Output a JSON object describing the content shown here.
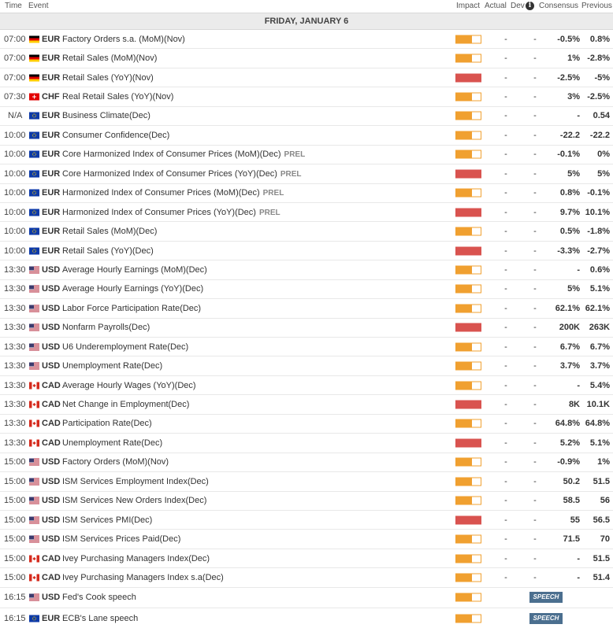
{
  "header": {
    "time": "Time",
    "event": "Event",
    "impact": "Impact",
    "actual": "Actual",
    "dev": "Dev",
    "info_icon": "i",
    "consensus": "Consensus",
    "previous": "Previous"
  },
  "day": "FRIDAY, JANUARY 6",
  "colors": {
    "impact_medium": "#f0a030",
    "impact_high": "#d9534f",
    "speech_badge": "#4b6f8f"
  },
  "rows": [
    {
      "time": "07:00",
      "flag": "de-flag",
      "currency": "EUR",
      "event": "Factory Orders s.a. (MoM)(Nov)",
      "prel": "",
      "impact": "medium",
      "actual": "-",
      "dev": "-",
      "consensus": "-0.5%",
      "previous": "0.8%"
    },
    {
      "time": "07:00",
      "flag": "de-flag",
      "currency": "EUR",
      "event": "Retail Sales (MoM)(Nov)",
      "prel": "",
      "impact": "medium",
      "actual": "-",
      "dev": "-",
      "consensus": "1%",
      "previous": "-2.8%"
    },
    {
      "time": "07:00",
      "flag": "de-flag",
      "currency": "EUR",
      "event": "Retail Sales (YoY)(Nov)",
      "prel": "",
      "impact": "high",
      "actual": "-",
      "dev": "-",
      "consensus": "-2.5%",
      "previous": "-5%"
    },
    {
      "time": "07:30",
      "flag": "ch-flag",
      "currency": "CHF",
      "event": "Real Retail Sales (YoY)(Nov)",
      "prel": "",
      "impact": "medium",
      "actual": "-",
      "dev": "-",
      "consensus": "3%",
      "previous": "-2.5%"
    },
    {
      "time": "N/A",
      "flag": "eu-flag",
      "currency": "EUR",
      "event": "Business Climate(Dec)",
      "prel": "",
      "impact": "medium",
      "actual": "-",
      "dev": "-",
      "consensus": "-",
      "previous": "0.54"
    },
    {
      "time": "10:00",
      "flag": "eu-flag",
      "currency": "EUR",
      "event": "Consumer Confidence(Dec)",
      "prel": "",
      "impact": "medium",
      "actual": "-",
      "dev": "-",
      "consensus": "-22.2",
      "previous": "-22.2"
    },
    {
      "time": "10:00",
      "flag": "eu-flag",
      "currency": "EUR",
      "event": "Core Harmonized Index of Consumer Prices (MoM)(Dec)",
      "prel": "PREL",
      "impact": "medium",
      "actual": "-",
      "dev": "-",
      "consensus": "-0.1%",
      "previous": "0%"
    },
    {
      "time": "10:00",
      "flag": "eu-flag",
      "currency": "EUR",
      "event": "Core Harmonized Index of Consumer Prices (YoY)(Dec)",
      "prel": "PREL",
      "impact": "high",
      "actual": "-",
      "dev": "-",
      "consensus": "5%",
      "previous": "5%"
    },
    {
      "time": "10:00",
      "flag": "eu-flag",
      "currency": "EUR",
      "event": "Harmonized Index of Consumer Prices (MoM)(Dec)",
      "prel": "PREL",
      "impact": "medium",
      "actual": "-",
      "dev": "-",
      "consensus": "0.8%",
      "previous": "-0.1%"
    },
    {
      "time": "10:00",
      "flag": "eu-flag",
      "currency": "EUR",
      "event": "Harmonized Index of Consumer Prices (YoY)(Dec)",
      "prel": "PREL",
      "impact": "high",
      "actual": "-",
      "dev": "-",
      "consensus": "9.7%",
      "previous": "10.1%"
    },
    {
      "time": "10:00",
      "flag": "eu-flag",
      "currency": "EUR",
      "event": "Retail Sales (MoM)(Dec)",
      "prel": "",
      "impact": "medium",
      "actual": "-",
      "dev": "-",
      "consensus": "0.5%",
      "previous": "-1.8%"
    },
    {
      "time": "10:00",
      "flag": "eu-flag",
      "currency": "EUR",
      "event": "Retail Sales (YoY)(Dec)",
      "prel": "",
      "impact": "high",
      "actual": "-",
      "dev": "-",
      "consensus": "-3.3%",
      "previous": "-2.7%"
    },
    {
      "time": "13:30",
      "flag": "us-flag",
      "currency": "USD",
      "event": "Average Hourly Earnings (MoM)(Dec)",
      "prel": "",
      "impact": "medium",
      "actual": "-",
      "dev": "-",
      "consensus": "-",
      "previous": "0.6%"
    },
    {
      "time": "13:30",
      "flag": "us-flag",
      "currency": "USD",
      "event": "Average Hourly Earnings (YoY)(Dec)",
      "prel": "",
      "impact": "medium",
      "actual": "-",
      "dev": "-",
      "consensus": "5%",
      "previous": "5.1%"
    },
    {
      "time": "13:30",
      "flag": "us-flag",
      "currency": "USD",
      "event": "Labor Force Participation Rate(Dec)",
      "prel": "",
      "impact": "medium",
      "actual": "-",
      "dev": "-",
      "consensus": "62.1%",
      "previous": "62.1%"
    },
    {
      "time": "13:30",
      "flag": "us-flag",
      "currency": "USD",
      "event": "Nonfarm Payrolls(Dec)",
      "prel": "",
      "impact": "high",
      "actual": "-",
      "dev": "-",
      "consensus": "200K",
      "previous": "263K"
    },
    {
      "time": "13:30",
      "flag": "us-flag",
      "currency": "USD",
      "event": "U6 Underemployment Rate(Dec)",
      "prel": "",
      "impact": "medium",
      "actual": "-",
      "dev": "-",
      "consensus": "6.7%",
      "previous": "6.7%"
    },
    {
      "time": "13:30",
      "flag": "us-flag",
      "currency": "USD",
      "event": "Unemployment Rate(Dec)",
      "prel": "",
      "impact": "medium",
      "actual": "-",
      "dev": "-",
      "consensus": "3.7%",
      "previous": "3.7%"
    },
    {
      "time": "13:30",
      "flag": "ca-flag",
      "currency": "CAD",
      "event": "Average Hourly Wages (YoY)(Dec)",
      "prel": "",
      "impact": "medium",
      "actual": "-",
      "dev": "-",
      "consensus": "-",
      "previous": "5.4%"
    },
    {
      "time": "13:30",
      "flag": "ca-flag",
      "currency": "CAD",
      "event": "Net Change in Employment(Dec)",
      "prel": "",
      "impact": "high",
      "actual": "-",
      "dev": "-",
      "consensus": "8K",
      "previous": "10.1K"
    },
    {
      "time": "13:30",
      "flag": "ca-flag",
      "currency": "CAD",
      "event": "Participation Rate(Dec)",
      "prel": "",
      "impact": "medium",
      "actual": "-",
      "dev": "-",
      "consensus": "64.8%",
      "previous": "64.8%"
    },
    {
      "time": "13:30",
      "flag": "ca-flag",
      "currency": "CAD",
      "event": "Unemployment Rate(Dec)",
      "prel": "",
      "impact": "high",
      "actual": "-",
      "dev": "-",
      "consensus": "5.2%",
      "previous": "5.1%"
    },
    {
      "time": "15:00",
      "flag": "us-flag",
      "currency": "USD",
      "event": "Factory Orders (MoM)(Nov)",
      "prel": "",
      "impact": "medium",
      "actual": "-",
      "dev": "-",
      "consensus": "-0.9%",
      "previous": "1%"
    },
    {
      "time": "15:00",
      "flag": "us-flag",
      "currency": "USD",
      "event": "ISM Services Employment Index(Dec)",
      "prel": "",
      "impact": "medium",
      "actual": "-",
      "dev": "-",
      "consensus": "50.2",
      "previous": "51.5"
    },
    {
      "time": "15:00",
      "flag": "us-flag",
      "currency": "USD",
      "event": "ISM Services New Orders Index(Dec)",
      "prel": "",
      "impact": "medium",
      "actual": "-",
      "dev": "-",
      "consensus": "58.5",
      "previous": "56"
    },
    {
      "time": "15:00",
      "flag": "us-flag",
      "currency": "USD",
      "event": "ISM Services PMI(Dec)",
      "prel": "",
      "impact": "high",
      "actual": "-",
      "dev": "-",
      "consensus": "55",
      "previous": "56.5"
    },
    {
      "time": "15:00",
      "flag": "us-flag",
      "currency": "USD",
      "event": "ISM Services Prices Paid(Dec)",
      "prel": "",
      "impact": "medium",
      "actual": "-",
      "dev": "-",
      "consensus": "71.5",
      "previous": "70"
    },
    {
      "time": "15:00",
      "flag": "ca-flag",
      "currency": "CAD",
      "event": "Ivey Purchasing Managers Index(Dec)",
      "prel": "",
      "impact": "medium",
      "actual": "-",
      "dev": "-",
      "consensus": "-",
      "previous": "51.5"
    },
    {
      "time": "15:00",
      "flag": "ca-flag",
      "currency": "CAD",
      "event": "Ivey Purchasing Managers Index s.a(Dec)",
      "prel": "",
      "impact": "medium",
      "actual": "-",
      "dev": "-",
      "consensus": "-",
      "previous": "51.4"
    },
    {
      "time": "16:15",
      "flag": "us-flag",
      "currency": "USD",
      "event": "Fed's Cook speech",
      "prel": "",
      "impact": "medium",
      "speech": "SPEECH"
    },
    {
      "time": "16:15",
      "flag": "eu-flag",
      "currency": "EUR",
      "event": "ECB's Lane speech",
      "prel": "",
      "impact": "medium",
      "speech": "SPEECH"
    }
  ]
}
